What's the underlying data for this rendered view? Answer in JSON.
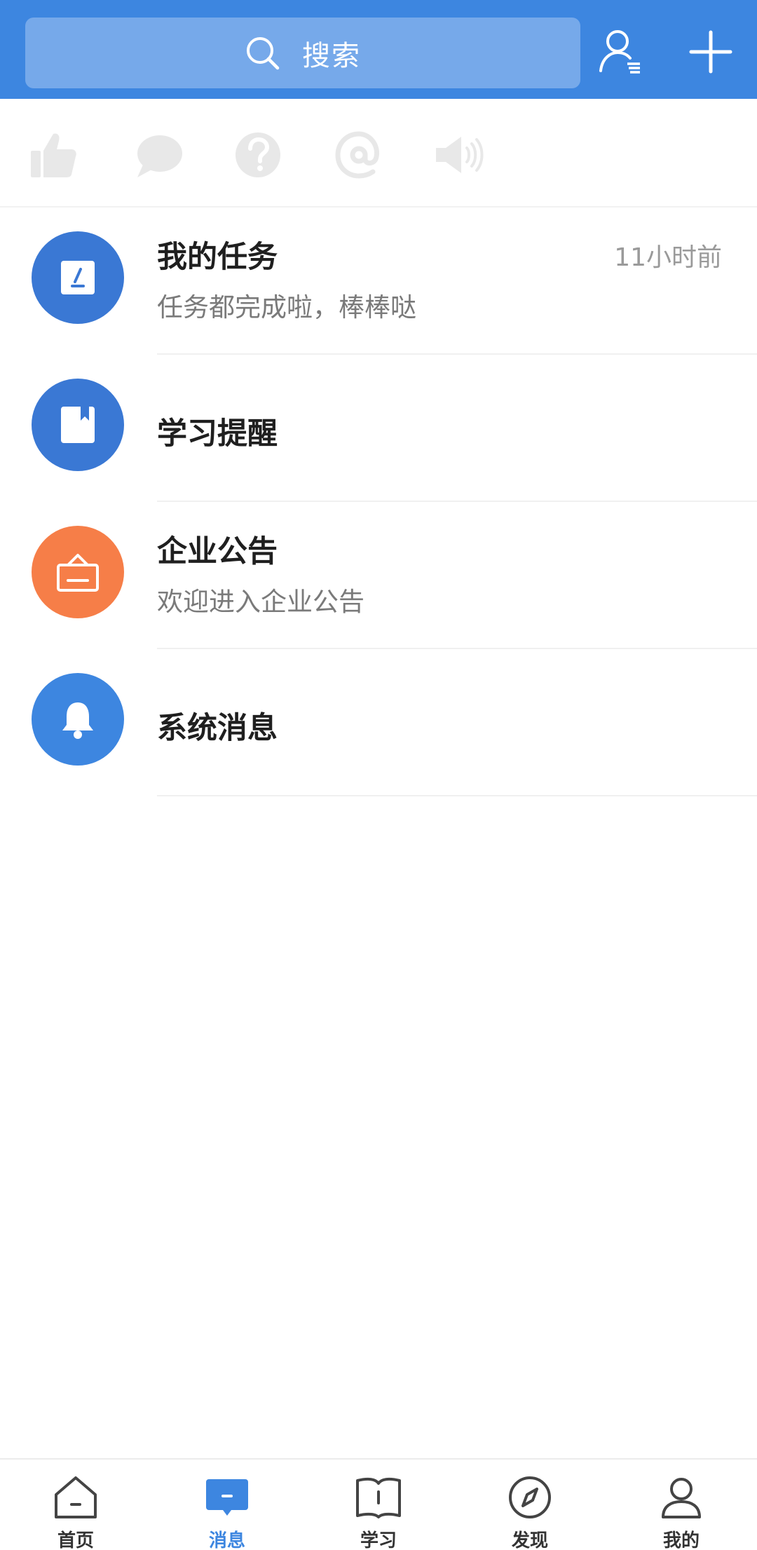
{
  "header": {
    "search_placeholder": "搜索",
    "contacts_icon": "contacts-icon",
    "add_icon": "plus-icon"
  },
  "quick_actions": [
    {
      "icon": "thumbs-up-icon"
    },
    {
      "icon": "comment-icon"
    },
    {
      "icon": "question-icon"
    },
    {
      "icon": "at-icon"
    },
    {
      "icon": "speaker-icon"
    }
  ],
  "messages": [
    {
      "title": "我的任务",
      "subtitle": "任务都完成啦，棒棒哒",
      "time": "11小时前",
      "icon": "edit-icon",
      "color": "#3a78d4"
    },
    {
      "title": "学习提醒",
      "subtitle": "",
      "time": "",
      "icon": "book-icon",
      "color": "#3a78d4"
    },
    {
      "title": "企业公告",
      "subtitle": "欢迎进入企业公告",
      "time": "",
      "icon": "notice-board-icon",
      "color": "#f67e48"
    },
    {
      "title": "系统消息",
      "subtitle": "",
      "time": "",
      "icon": "bell-icon",
      "color": "#3d86e0"
    }
  ],
  "tabs": [
    {
      "label": "首页",
      "icon": "home-icon",
      "active": false
    },
    {
      "label": "消息",
      "icon": "message-icon",
      "active": true
    },
    {
      "label": "学习",
      "icon": "book-icon",
      "active": false
    },
    {
      "label": "发现",
      "icon": "compass-icon",
      "active": false
    },
    {
      "label": "我的",
      "icon": "user-icon",
      "active": false
    }
  ],
  "colors": {
    "primary": "#3d86e0",
    "search_bg": "#76a9ea",
    "orange": "#f67e48",
    "quick_icon": "#e8e8e8"
  }
}
